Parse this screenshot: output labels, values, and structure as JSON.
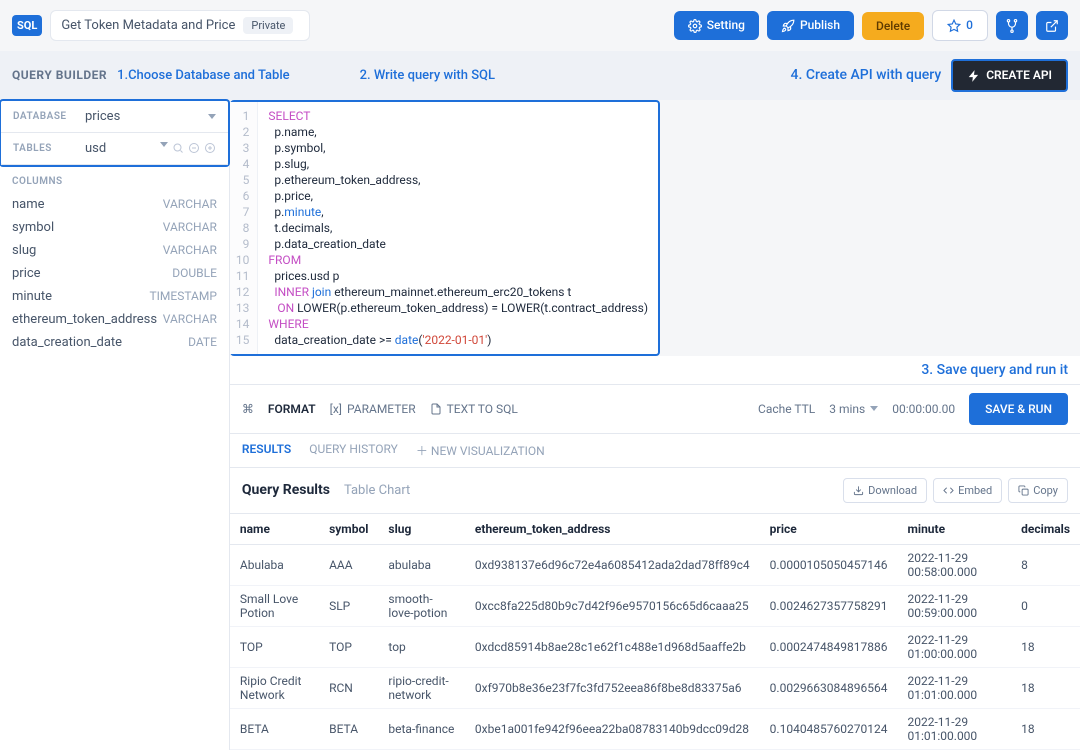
{
  "header": {
    "logo": "SQL",
    "title": "Get Token Metadata and Price",
    "visibility": "Private",
    "setting": "Setting",
    "publish": "Publish",
    "delete": "Delete",
    "stars": "0"
  },
  "query_builder": {
    "label": "QUERY BUILDER",
    "callouts": {
      "c1": "1.Choose Database and Table",
      "c2": "2. Write query with SQL",
      "c3": "3. Save query and run it",
      "c4": "4. Create API with query"
    },
    "create_api": "CREATE API"
  },
  "sidebar": {
    "db_label": "DATABASE",
    "db_value": "prices",
    "tables_label": "TABLES",
    "tables_value": "usd",
    "columns_label": "COLUMNS",
    "columns": [
      {
        "name": "name",
        "type": "VARCHAR"
      },
      {
        "name": "symbol",
        "type": "VARCHAR"
      },
      {
        "name": "slug",
        "type": "VARCHAR"
      },
      {
        "name": "price",
        "type": "DOUBLE"
      },
      {
        "name": "minute",
        "type": "TIMESTAMP"
      },
      {
        "name": "ethereum_token_address",
        "type": "VARCHAR"
      },
      {
        "name": "data_creation_date",
        "type": "DATE"
      }
    ]
  },
  "editor": {
    "lines": 15,
    "code_plain": "SELECT\n  p.name,\n  p.symbol,\n  p.slug,\n  p.ethereum_token_address,\n  p.price,\n  p.minute,\n  t.decimals,\n  p.data_creation_date\nFROM\n  prices.usd p\n  INNER join ethereum_mainnet.ethereum_erc20_tokens t\n   ON LOWER(p.ethereum_token_address) = LOWER(t.contract_address)\nWHERE\n  data_creation_date >= date('2022-01-01')"
  },
  "runbar": {
    "format": "FORMAT",
    "parameter": "PARAMETER",
    "text_to_sql": "TEXT TO SQL",
    "cache_label": "Cache TTL",
    "cache_value": "3 mins",
    "timer": "00:00:00.00",
    "save_run": "SAVE & RUN"
  },
  "tabs": {
    "results": "RESULTS",
    "history": "QUERY HISTORY",
    "newvis": "NEW VISUALIZATION"
  },
  "results": {
    "title": "Query Results",
    "view": "Table Chart",
    "download": "Download",
    "embed": "Embed",
    "copy": "Copy",
    "columns": [
      "name",
      "symbol",
      "slug",
      "ethereum_token_address",
      "price",
      "minute",
      "decimals"
    ],
    "rows": [
      {
        "name": "Abulaba",
        "symbol": "AAA",
        "slug": "abulaba",
        "address": "0xd938137e6d96c72e4a6085412ada2dad78ff89c4",
        "price": "0.0000105050457146",
        "minute": "2022-11-29 00:58:00.000",
        "decimals": "8"
      },
      {
        "name": "Small Love Potion",
        "symbol": "SLP",
        "slug": "smooth-love-potion",
        "address": "0xcc8fa225d80b9c7d42f96e9570156c65d6caaa25",
        "price": "0.0024627357758291",
        "minute": "2022-11-29 00:59:00.000",
        "decimals": "0"
      },
      {
        "name": "TOP",
        "symbol": "TOP",
        "slug": "top",
        "address": "0xdcd85914b8ae28c1e62f1c488e1d968d5aaffe2b",
        "price": "0.0002474849817886",
        "minute": "2022-11-29 01:00:00.000",
        "decimals": "18"
      },
      {
        "name": "Ripio Credit Network",
        "symbol": "RCN",
        "slug": "ripio-credit-network",
        "address": "0xf970b8e36e23f7fc3fd752eea86f8be8d83375a6",
        "price": "0.0029663084896564",
        "minute": "2022-11-29 01:01:00.000",
        "decimals": "18"
      },
      {
        "name": "BETA",
        "symbol": "BETA",
        "slug": "beta-finance",
        "address": "0xbe1a001fe942f96eea22ba08783140b9dcc09d28",
        "price": "0.1040485760270124",
        "minute": "2022-11-29 01:01:00.000",
        "decimals": "18"
      }
    ]
  }
}
